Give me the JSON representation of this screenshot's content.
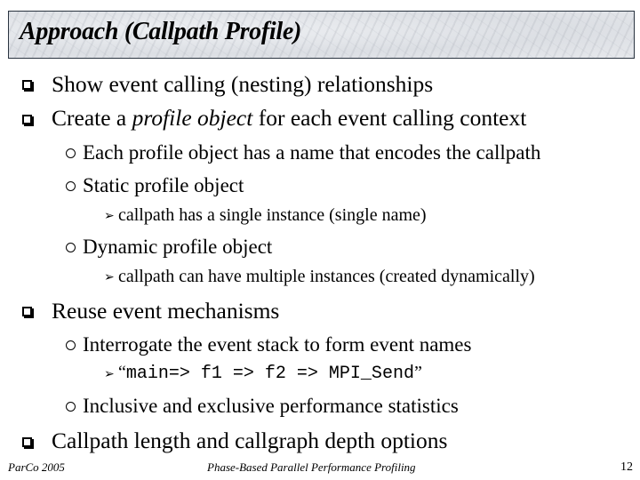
{
  "slide": {
    "title": "Approach (Callpath Profile)",
    "bullets": {
      "b1": "Show event calling (nesting) relationships",
      "b2_pre": "Create a ",
      "b2_em": "profile object",
      "b2_post": " for each event calling context",
      "b2_1": "Each profile object has a name that encodes the callpath",
      "b2_2": "Static profile object",
      "b2_2_1": "callpath has a single instance (single name)",
      "b2_3": "Dynamic profile object",
      "b2_3_1": "callpath can have multiple instances (created dynamically)",
      "b3": "Reuse event mechanisms",
      "b3_1": "Interrogate the event stack to form event names",
      "b3_1_1_open": "“",
      "b3_1_1_code": "main=> f1 => f2 => MPI_Send",
      "b3_1_1_close": "”",
      "b3_2": "Inclusive and exclusive performance statistics",
      "b4": "Callpath length and callgraph depth options"
    }
  },
  "footer": {
    "left": "ParCo 2005",
    "center": "Phase-Based Parallel Performance Profiling",
    "page": "12"
  }
}
